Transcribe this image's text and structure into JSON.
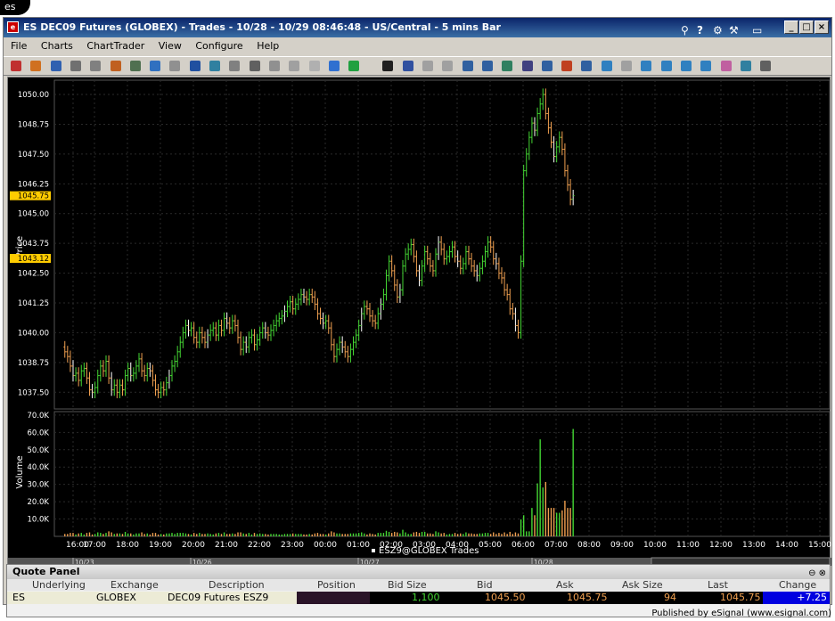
{
  "tab_tag": "es",
  "window": {
    "title": "ES DEC09 Futures (GLOBEX) - Trades - 10/28 - 10/29 08:46:48 - US/Central - 5 mins Bar"
  },
  "menu": [
    "File",
    "Charts",
    "ChartTrader",
    "View",
    "Configure",
    "Help"
  ],
  "toolbar_icons": [
    "crosshair-icon",
    "cursor-icon",
    "clock-icon",
    "grid-icon",
    "print-icon",
    "gauge-icon",
    "table-icon",
    "zoom-icon",
    "circle-icon",
    "bar-icon",
    "chart-icon",
    "square-icon",
    "dot-icon",
    "circle-icon",
    "bars-icon",
    "bars-icon",
    "area-icon",
    "green-circle-icon",
    "plus-icon",
    "line-tool-icon",
    "undo-icon",
    "redo-icon",
    "hline-icon",
    "vline-icon",
    "trend-icon",
    "pen-icon",
    "channel-icon",
    "zoom-in-icon",
    "zoom-out-icon",
    "scroll-left-icon",
    "scroll-left-end-icon",
    "compress-icon",
    "expand-icon",
    "scroll-right-icon",
    "scroll-right-end-icon",
    "palette-icon",
    "refresh-icon",
    "settings-icon"
  ],
  "chart": {
    "price_panel_label": "Price",
    "volume_panel_label": "Volume",
    "price_ticks": [
      "1050.00",
      "1048.75",
      "1047.50",
      "1046.25",
      "1045.00",
      "1043.75",
      "1042.50",
      "1041.25",
      "1040.00",
      "1038.75",
      "1037.50"
    ],
    "price_marker_top": "1045.75",
    "price_marker_bottom": "1043.12",
    "volume_ticks": [
      "70.0K",
      "60.0K",
      "50.0K",
      "40.0K",
      "30.0K",
      "20.0K",
      "10.0K"
    ],
    "time_labels": [
      "16:00",
      "17:00",
      "18:00",
      "19:00",
      "20:00",
      "21:00",
      "22:00",
      "23:00",
      "00:00",
      "01:00",
      "02:00",
      "03:00",
      "04:00",
      "05:00",
      "06:00",
      "07:00",
      "08:00",
      "09:00",
      "10:00",
      "11:00",
      "12:00",
      "13:00",
      "14:00",
      "15:00"
    ],
    "legend": "ESZ9@GLOBEX Trades",
    "date_labels": [
      "10/23",
      "10/26",
      "10/27",
      "10/28",
      "10/29"
    ],
    "colors": {
      "up": "#44d633",
      "down": "#f0a050",
      "neutral": "#ffffff",
      "grid": "#2a2a2a",
      "marker_bg": "#ffcc00"
    }
  },
  "chart_data": {
    "type": "candlestick",
    "ylim": [
      1036.8,
      1050.6
    ],
    "volume_ylim": [
      0,
      72000
    ],
    "time_start": "15:45",
    "bar_minutes": 5,
    "closes": [
      1039.2,
      1039.0,
      1038.6,
      1038.2,
      1038.3,
      1038.0,
      1038.4,
      1038.5,
      1038.1,
      1037.6,
      1037.5,
      1037.7,
      1038.2,
      1038.6,
      1038.4,
      1038.8,
      1038.1,
      1037.6,
      1037.8,
      1037.5,
      1037.8,
      1037.6,
      1038.2,
      1038.5,
      1038.2,
      1038.3,
      1038.6,
      1038.9,
      1038.4,
      1038.2,
      1038.5,
      1038.4,
      1038.0,
      1037.6,
      1037.5,
      1037.7,
      1037.6,
      1037.9,
      1038.2,
      1038.6,
      1038.8,
      1039.2,
      1039.6,
      1040.0,
      1040.3,
      1040.1,
      1040.2,
      1039.8,
      1039.6,
      1040.0,
      1039.8,
      1039.6,
      1039.9,
      1040.1,
      1040.2,
      1039.9,
      1040.3,
      1040.1,
      1040.6,
      1040.4,
      1040.2,
      1040.5,
      1040.3,
      1039.8,
      1039.3,
      1039.6,
      1039.4,
      1039.8,
      1039.9,
      1039.5,
      1039.7,
      1040.0,
      1040.2,
      1040.0,
      1039.9,
      1040.1,
      1040.3,
      1040.5,
      1040.6,
      1040.7,
      1040.9,
      1041.1,
      1041.3,
      1041.0,
      1041.2,
      1041.4,
      1041.6,
      1041.5,
      1041.4,
      1041.6,
      1041.5,
      1041.2,
      1040.8,
      1040.6,
      1040.4,
      1040.5,
      1040.2,
      1039.5,
      1039.0,
      1039.3,
      1039.6,
      1039.4,
      1039.2,
      1039.0,
      1039.3,
      1039.6,
      1039.9,
      1040.3,
      1040.8,
      1041.1,
      1041.0,
      1040.7,
      1040.5,
      1040.4,
      1040.8,
      1041.2,
      1041.6,
      1042.4,
      1043.0,
      1042.6,
      1042.0,
      1041.5,
      1041.8,
      1042.8,
      1043.3,
      1043.5,
      1043.7,
      1043.2,
      1042.6,
      1042.2,
      1042.8,
      1043.4,
      1043.1,
      1042.8,
      1042.6,
      1043.3,
      1043.8,
      1043.5,
      1043.1,
      1043.2,
      1043.4,
      1043.6,
      1043.2,
      1043.0,
      1042.7,
      1042.9,
      1043.4,
      1043.1,
      1042.8,
      1042.6,
      1042.4,
      1042.7,
      1043.0,
      1043.4,
      1043.8,
      1043.6,
      1043.1,
      1042.9,
      1042.5,
      1042.3,
      1041.8,
      1041.6,
      1041.0,
      1040.8,
      1040.3,
      1040.0,
      1043.0,
      1046.8,
      1047.5,
      1048.2,
      1048.8,
      1048.5,
      1049.2,
      1049.6,
      1050.0,
      1049.2,
      1048.6,
      1048.0,
      1047.4,
      1047.8,
      1048.2,
      1047.7,
      1046.8,
      1046.2,
      1045.6,
      1045.75
    ]
  },
  "quote_panel": {
    "title": "Quote Panel",
    "columns": [
      "Underlying",
      "Exchange",
      "Description",
      "Position",
      "Bid Size",
      "Bid",
      "Ask",
      "Ask Size",
      "Last",
      "Change"
    ],
    "row": {
      "underlying": "ES",
      "exchange": "GLOBEX",
      "description": "DEC09 Futures ESZ9",
      "position": "",
      "bid_size": "1,100",
      "bid": "1045.50",
      "ask": "1045.75",
      "ask_size": "94",
      "last": "1045.75",
      "change": "+7.25"
    }
  },
  "footer": "Published by eSignal (www.esignal.com)"
}
